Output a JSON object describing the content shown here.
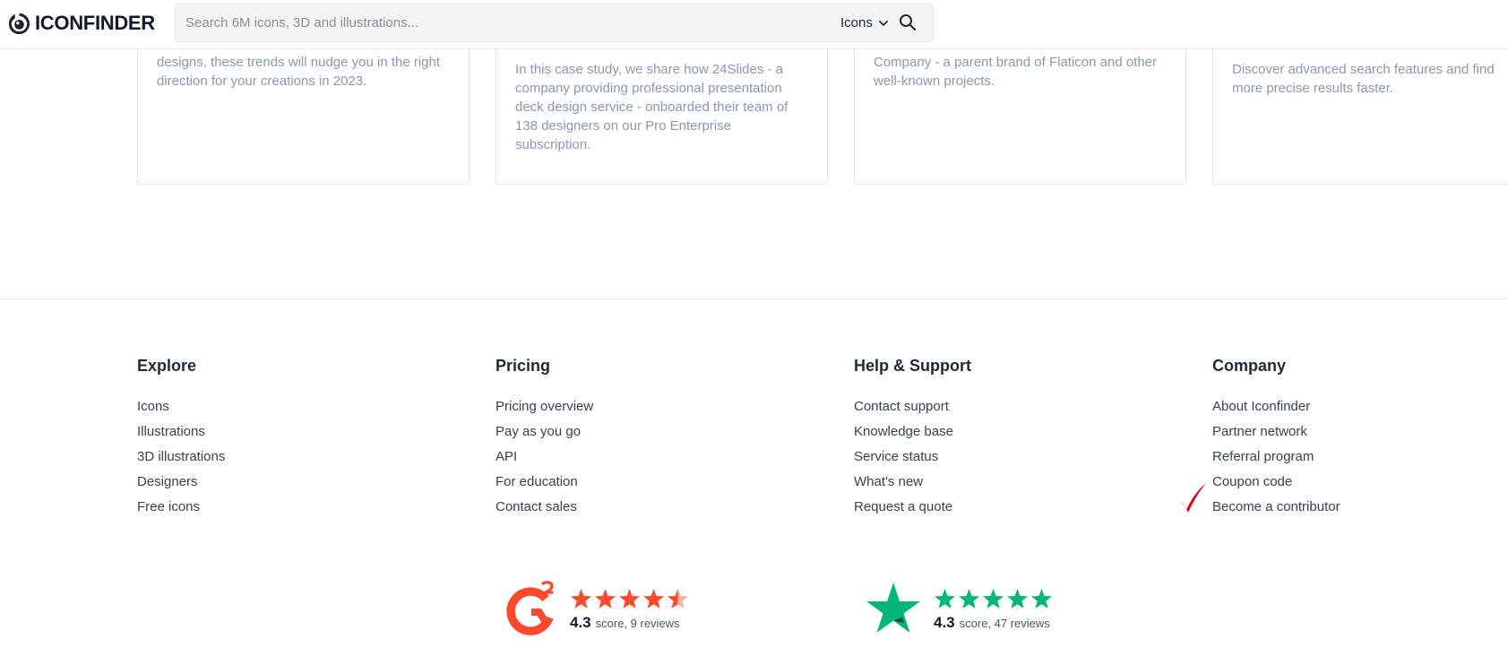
{
  "header": {
    "logo_text": "ICONFINDER",
    "search_placeholder": "Search 6M icons, 3D and illustrations...",
    "search_type": "Icons"
  },
  "cards": [
    {
      "text_lines": [
        "designs, these trends will nudge you in the right",
        "direction for your creations in 2023."
      ]
    },
    {
      "text_lines": [
        "In this case study, we share how 24Slides - a",
        "company providing professional presentation",
        "deck design service - onboarded their team of",
        "138 designers on our Pro Enterprise",
        "subscription."
      ]
    },
    {
      "text_lines": [
        "Company - a parent brand of Flaticon and other",
        "well-known projects."
      ]
    },
    {
      "text_lines": [
        "Discover advanced search features and find",
        "more precise results faster."
      ]
    }
  ],
  "footer": {
    "columns": [
      {
        "title": "Explore",
        "links": [
          "Icons",
          "Illustrations",
          "3D illustrations",
          "Designers",
          "Free icons"
        ]
      },
      {
        "title": "Pricing",
        "links": [
          "Pricing overview",
          "Pay as you go",
          "API",
          "For education",
          "Contact sales"
        ]
      },
      {
        "title": "Help & Support",
        "links": [
          "Contact support",
          "Knowledge base",
          "Service status",
          "What's new",
          "Request a quote"
        ]
      },
      {
        "title": "Company",
        "links": [
          "About Iconfinder",
          "Partner network",
          "Referral program",
          "Coupon code",
          "Become a contributor"
        ]
      }
    ]
  },
  "ratings": [
    {
      "name": "g2",
      "score": "4.3",
      "meta": "score, 9 reviews",
      "star_color": "#ff492c",
      "stars_filled": 4.5
    },
    {
      "name": "trustpilot",
      "score": "4.3",
      "meta": "score, 47 reviews",
      "star_color": "#00b67a",
      "stars_filled": 5
    }
  ],
  "colors": {
    "card_text": "#8b97ad",
    "g2_red": "#ff492c",
    "trustpilot_green": "#00b67a",
    "checkmark_red": "#e3001b"
  }
}
